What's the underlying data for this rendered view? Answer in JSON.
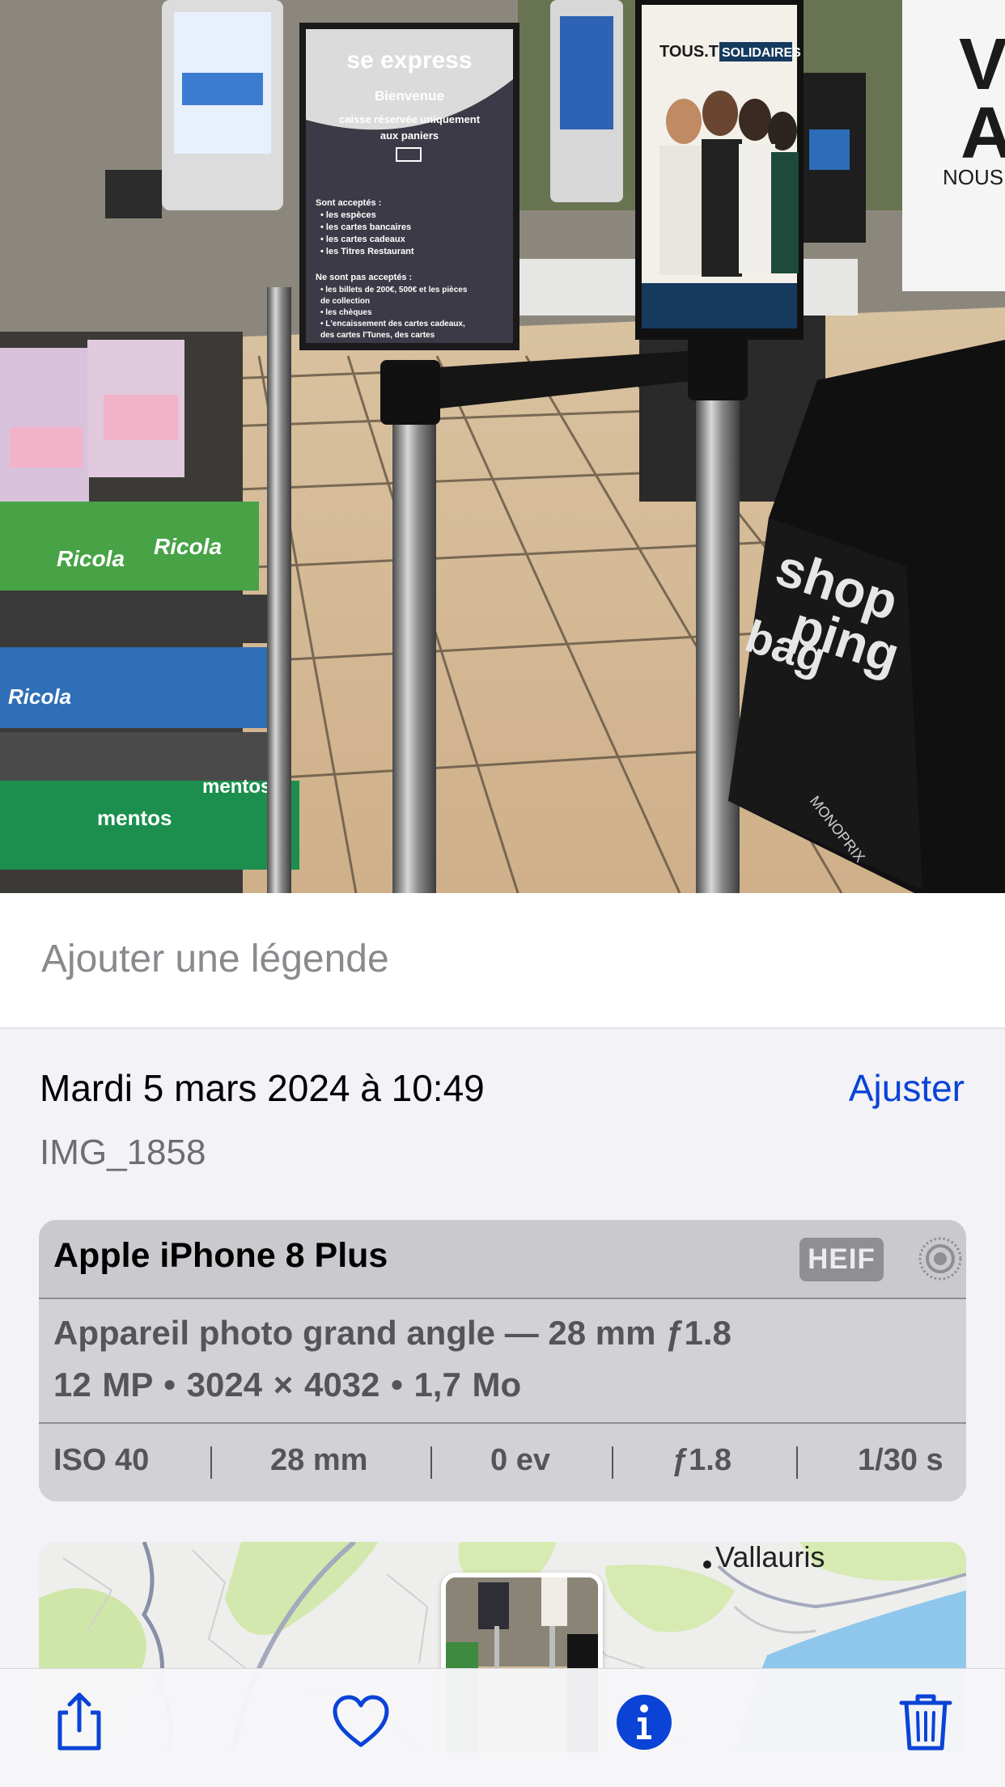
{
  "caption": {
    "placeholder": "Ajouter une légende"
  },
  "info": {
    "date_time": "Mardi 5 mars 2024 à 10:49",
    "adjust_label": "Ajuster",
    "file_name": "IMG_1858"
  },
  "camera": {
    "device": "Apple iPhone 8 Plus",
    "format_badge": "HEIF",
    "lens": "Appareil photo grand angle — 28 mm ƒ1.8",
    "specs": "12 MP  •  3024 × 4032  •  1,7 Mo",
    "exif": {
      "iso": "ISO 40",
      "focal": "28 mm",
      "ev": "0 ev",
      "aperture": "ƒ1.8",
      "shutter": "1/30 s"
    }
  },
  "map": {
    "place_label": "Vallauris"
  },
  "photo_text": {
    "sign_title": "se express",
    "sign_welcome": "Bienvenue",
    "sign_line1": "caisse réservée uniquement",
    "sign_line2": "aux paniers",
    "sign_accepted": "Sont acceptés :",
    "sign_items": [
      "• les espèces",
      "• les cartes bancaires",
      "• les cartes cadeaux",
      "• les Titres Restaurant"
    ],
    "sign_refused": "Ne sont pas acceptés :",
    "sign_refused_items": [
      "• les billets de 200€, 500€ et les pièces",
      "  de collection",
      "• les chèques",
      "• L'encaissement des cartes cadeaux,",
      "  des cartes l'Tunes, des cartes"
    ],
    "poster_title": "TOUS.TES",
    "poster_highlight": "SOLIDAIRES",
    "poster_right": "VO",
    "poster_right2": "AV",
    "poster_right3": "NOUS IN",
    "bag_text_1": "shop",
    "bag_text_2": "ping",
    "bag_text_3": "bag",
    "bag_brand": "MONOPRIX",
    "product_brand": "Ricola",
    "product_brand_2": "mentos"
  },
  "colors": {
    "accent": "#0a43d6",
    "background": "#f2f2f7",
    "card": "#d1d1d6"
  },
  "toolbar": {
    "icons": [
      "share-icon",
      "heart-icon",
      "info-icon",
      "trash-icon"
    ]
  }
}
